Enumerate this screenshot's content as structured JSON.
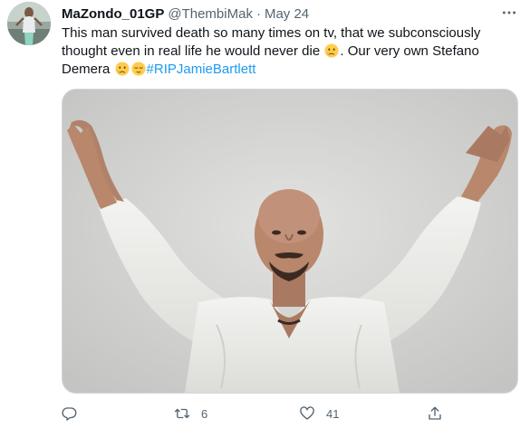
{
  "tweet": {
    "display_name": "MaZondo_01GP",
    "handle": "@ThembiMak",
    "separator": "·",
    "date": "May 24",
    "text_line1": "This man survived death so many times on tv, that we subconsciously",
    "text_line2": "thought even in real life he would never die",
    "text_line3": ". Our very own Stefano",
    "text_line4": "Demera",
    "hashtag": "#RIPJamieBartlett",
    "emoji_1": "crying-face-emoji",
    "emoji_2": "crying-face-emoji",
    "emoji_3": "relieved-face-emoji",
    "media_description_icon": "photo-image",
    "more_icon": "more-horizontal-icon",
    "actions": {
      "reply_icon": "reply-icon",
      "retweet_icon": "retweet-icon",
      "retweet_count": "6",
      "like_icon": "heart-icon",
      "like_count": "41",
      "share_icon": "share-icon"
    },
    "colors": {
      "accent": "#1d9bf0",
      "secondary_text": "#536471",
      "primary_text": "#0f1419",
      "border": "#cfd9de"
    }
  }
}
